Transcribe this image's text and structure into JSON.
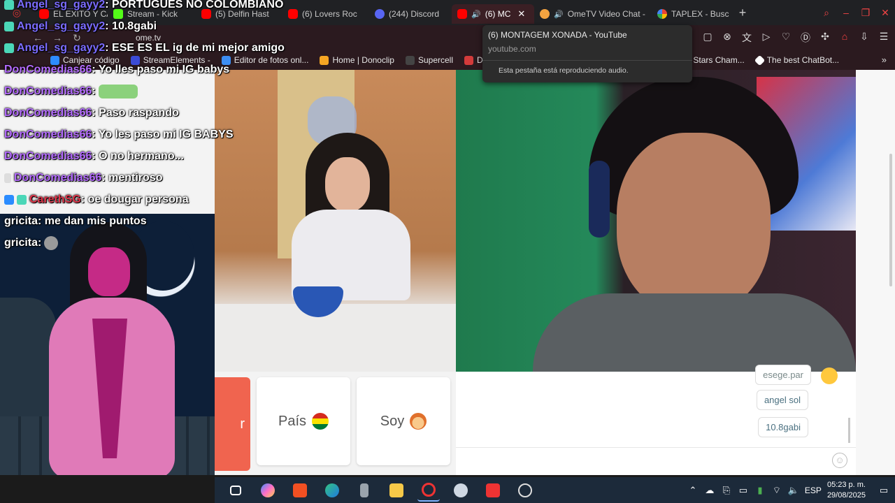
{
  "browser": {
    "tabs": [
      {
        "label": "EL EXITO Y CA",
        "icon": "youtube-icon"
      },
      {
        "label": "Stream - Kick",
        "icon": "kick-icon"
      },
      {
        "label": "(5) Delfin Hast",
        "icon": "youtube-icon"
      },
      {
        "label": "(6) Lovers Roc",
        "icon": "youtube-icon"
      },
      {
        "label": "(244) Discord",
        "icon": "discord-icon"
      },
      {
        "label": "(6) MC",
        "icon": "youtube-icon",
        "active": true
      },
      {
        "label": "OmeTV Video Chat -",
        "icon": "ometv-icon"
      },
      {
        "label": "TAPLEX - Busc",
        "icon": "google-icon"
      }
    ],
    "url": "ome.tv",
    "bookmarks": [
      {
        "label": "Canjear código",
        "color": "#2d8cff"
      },
      {
        "label": "StreamElements -",
        "color": "#3b4bd6"
      },
      {
        "label": "Editor de fotos onl...",
        "color": "#3c8ef3"
      },
      {
        "label": "Home | Donoclip",
        "color": "#f5a623"
      },
      {
        "label": "Supercell",
        "color": "#444444"
      },
      {
        "label": "D",
        "color": "#d33b3b"
      },
      {
        "label": "wl Stars Cham...",
        "color": "#8a6df2"
      },
      {
        "label": "The best ChatBot...",
        "color": "#ffffff"
      }
    ],
    "tooltip": {
      "title": "(6) MONTAGEM XONADA - YouTube",
      "domain": "youtube.com",
      "audio_note": "Esta pestaña está reproduciendo audio."
    }
  },
  "overlay_chat": [
    {
      "user": "Angel_sg_gayy2",
      "message": ": PORTUGUES NO COLOMBIANO",
      "color": "#7b6cff"
    },
    {
      "user": "Angel_sg_gayy2",
      "message": ": 10.8gabi",
      "color": "#7b6cff"
    },
    {
      "user": "Angel_sg_gayy2",
      "message": ": ESE ES EL ig de mi mejor amigo",
      "color": "#7b6cff"
    },
    {
      "user": "DonComedias66",
      "message": ": Yo lles paso mi IG babys",
      "color": "#b56cff"
    },
    {
      "user": "DonComedias66",
      "message": ":",
      "color": "#b56cff"
    },
    {
      "user": "DonComedias66",
      "message": ": Paso raspando",
      "color": "#b56cff"
    },
    {
      "user": "DonComedias66",
      "message": ": Yo les paso mi IG BABYS",
      "color": "#b56cff"
    },
    {
      "user": "DonComedias66",
      "message": ": O no hermano...",
      "color": "#b56cff"
    },
    {
      "user": "DonComedias66",
      "message": ": mentiroso",
      "color": "#b56cff"
    },
    {
      "user": "CarethSG",
      "message": ": oe dougar persona",
      "color": "#e0354a"
    },
    {
      "user": "gricita",
      "message": ": me dan mis puntos",
      "color": "#ffffff"
    },
    {
      "user": "gricita",
      "message": ":",
      "color": "#ffffff"
    }
  ],
  "ometv": {
    "chat_messages": [
      "esege.par",
      "angel sol",
      "10.8gabi"
    ],
    "country_label": "País",
    "gender_label": "Soy",
    "next_label": "r"
  },
  "taskbar": {
    "language": "ESP",
    "time": "05:23 p. m.",
    "date": "29/08/2025"
  }
}
